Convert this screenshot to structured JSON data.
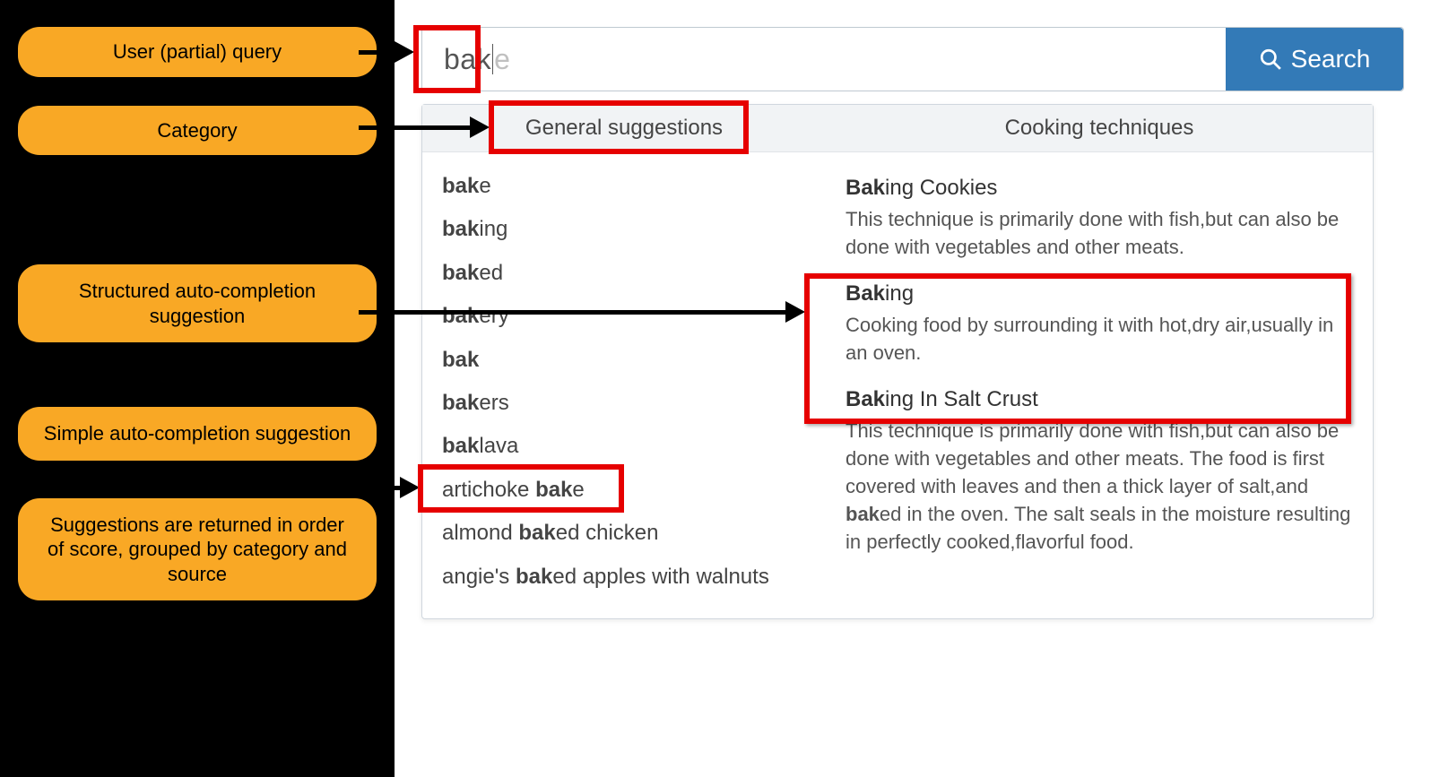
{
  "annotations": {
    "user_query": "User (partial) query",
    "category": "Category",
    "structured": "Structured auto-completion suggestion",
    "simple": "Simple auto-completion suggestion",
    "note": "Suggestions are returned in order of score, grouped by category and source"
  },
  "search": {
    "typed": "bak",
    "ghost": "e",
    "button_label": "Search"
  },
  "dropdown": {
    "general": {
      "header": "General suggestions",
      "items": [
        {
          "prefix": "bak",
          "rest": "e"
        },
        {
          "prefix": "bak",
          "rest": "ing"
        },
        {
          "prefix": "bak",
          "rest": "ed"
        },
        {
          "prefix": "bak",
          "rest": "ery"
        },
        {
          "prefix": "bak",
          "rest": ""
        },
        {
          "prefix": "bak",
          "rest": "ers"
        },
        {
          "prefix": "bak",
          "rest": "lava"
        },
        {
          "pre": "artichoke ",
          "prefix": "bak",
          "rest": "e"
        },
        {
          "pre": "almond ",
          "prefix": "bak",
          "rest": "ed chicken"
        },
        {
          "pre": "angie's ",
          "prefix": "bak",
          "rest": "ed apples with walnuts"
        }
      ]
    },
    "techniques": {
      "header": "Cooking techniques",
      "items": [
        {
          "title_bold": "Bak",
          "title_rest": "ing Cookies",
          "desc_pre": "This technique is primarily done with fish,but can also be done with vegetables and other meats.",
          "desc_bold": "",
          "desc_post": ""
        },
        {
          "title_bold": "Bak",
          "title_rest": "ing",
          "desc_pre": "Cooking food by surrounding it with hot,dry air,usually in an oven.",
          "desc_bold": "",
          "desc_post": ""
        },
        {
          "title_bold": "Bak",
          "title_rest": "ing In Salt Crust",
          "desc_pre": "This technique is primarily done with fish,but can also be done with vegetables and other meats. The food is first covered with leaves and then a thick layer of salt,and ",
          "desc_bold": "bak",
          "desc_post": "ed in the oven. The salt seals in the moisture resulting in perfectly cooked,flavorful food."
        }
      ]
    }
  },
  "colors": {
    "highlight": "#e60000",
    "pill": "#f9a825",
    "button": "#337ab7"
  }
}
